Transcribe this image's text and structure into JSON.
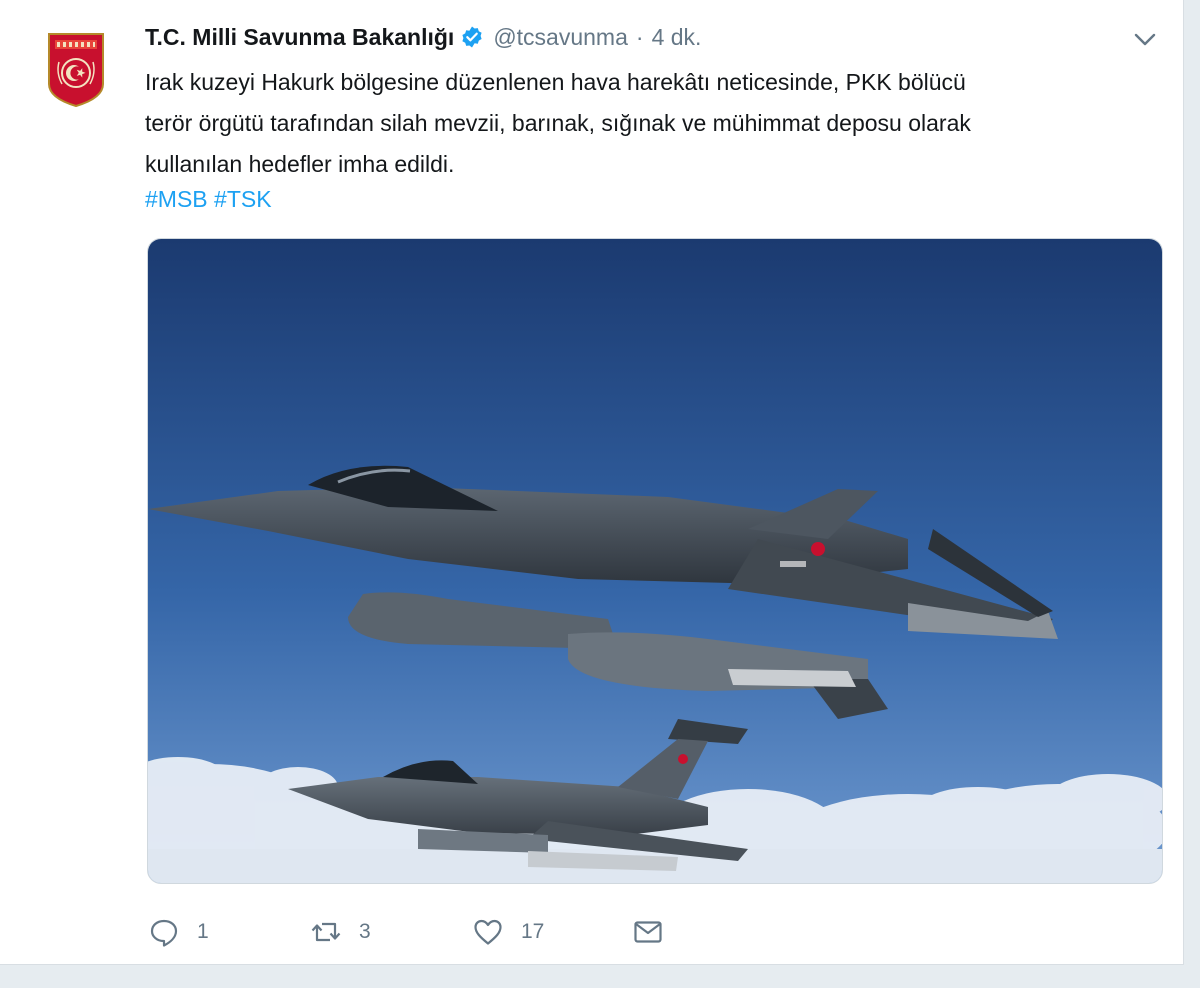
{
  "tweet": {
    "display_name": "T.C. Milli Savunma Bakanlığı",
    "handle": "@tcsavunma",
    "separator": "·",
    "time": "4 dk.",
    "text_lines": [
      "Irak kuzeyi Hakurk bölgesine düzenlenen hava harekâtı neticesinde, PKK bölücü",
      "terör örgütü tarafından silah mevzii, barınak, sığınak ve mühimmat deposu olarak",
      "kullanılan hedefler imha edildi."
    ],
    "hashtags": [
      "#MSB",
      "#TSK"
    ]
  },
  "actions": {
    "reply_count": "1",
    "retweet_count": "3",
    "like_count": "17"
  },
  "icons": {
    "verified": "verified-badge-icon",
    "caret": "chevron-down-icon",
    "reply": "reply-icon",
    "retweet": "retweet-icon",
    "like": "heart-icon",
    "dm": "envelope-icon"
  },
  "colors": {
    "link": "#1da1f2",
    "text": "#14171a",
    "muted": "#657786",
    "sky_top": "#1b3a70",
    "sky_bottom": "#5f8fcb",
    "emblem_red": "#c8102e"
  }
}
